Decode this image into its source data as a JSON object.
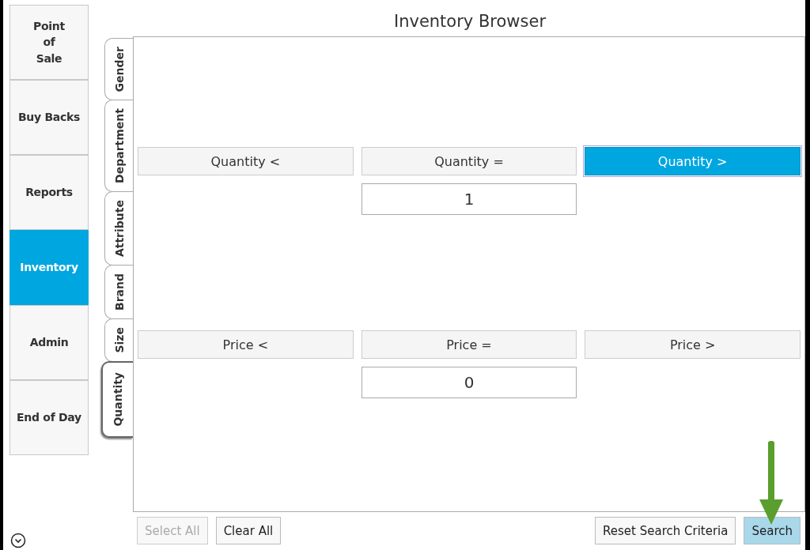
{
  "sidebar": {
    "items": [
      {
        "label": "Point\nof\nSale",
        "selected": false
      },
      {
        "label": "Buy Backs",
        "selected": false
      },
      {
        "label": "Reports",
        "selected": false
      },
      {
        "label": "Inventory",
        "selected": true
      },
      {
        "label": "Admin",
        "selected": false
      },
      {
        "label": "End of Day",
        "selected": false
      }
    ]
  },
  "title": "Inventory Browser",
  "tabs": [
    {
      "label": "Gender",
      "selected": false
    },
    {
      "label": "Department",
      "selected": false
    },
    {
      "label": "Attribute",
      "selected": false
    },
    {
      "label": "Brand",
      "selected": false
    },
    {
      "label": "Size",
      "selected": false
    },
    {
      "label": "Quantity",
      "selected": true
    }
  ],
  "criteria": [
    {
      "options": [
        {
          "label": "Quantity <",
          "selected": false
        },
        {
          "label": "Quantity =",
          "selected": false
        },
        {
          "label": "Quantity >",
          "selected": true
        }
      ],
      "value": "1"
    },
    {
      "options": [
        {
          "label": "Price <",
          "selected": false
        },
        {
          "label": "Price =",
          "selected": false
        },
        {
          "label": "Price >",
          "selected": false
        }
      ],
      "value": "0"
    }
  ],
  "footer_left": [
    {
      "label": "Select All",
      "disabled": true
    },
    {
      "label": "Clear All",
      "disabled": false
    }
  ],
  "footer_right": [
    {
      "label": "Reset Search Criteria",
      "highlighted": false
    },
    {
      "label": "Search",
      "highlighted": true
    }
  ]
}
